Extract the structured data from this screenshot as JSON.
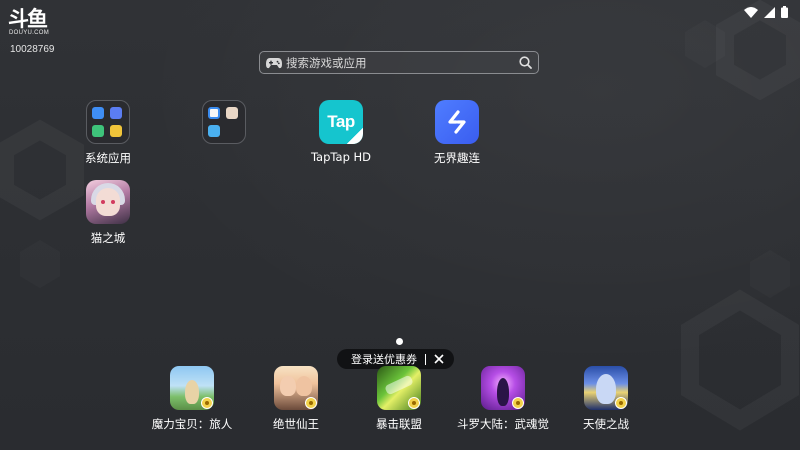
{
  "brand": {
    "logo_mark": "斗鱼",
    "logo_sub": "DOUYU.COM",
    "device_id": "10028769"
  },
  "status_bar": {
    "icons": [
      "wifi-icon",
      "signal-icon",
      "battery-icon"
    ]
  },
  "search": {
    "placeholder": "搜索游戏或应用",
    "left_icon": "gamepad-icon",
    "right_icon": "search-icon"
  },
  "apps": [
    {
      "label": "系统应用",
      "icon": "folder-icon"
    },
    {
      "label": "",
      "icon": "folder-icon"
    },
    {
      "label": "TapTap HD",
      "icon": "taptap-icon",
      "tile_text": "Tap"
    },
    {
      "label": "无界趣连",
      "icon": "wujie-icon"
    },
    {
      "label": "猫之城",
      "icon": "game-cat-icon"
    }
  ],
  "pager": {
    "current": 1
  },
  "toast": {
    "text": "登录送优惠券",
    "close_icon": "close-icon"
  },
  "dock": [
    {
      "label": "魔力宝贝：旅人"
    },
    {
      "label": "绝世仙王"
    },
    {
      "label": "暴击联盟"
    },
    {
      "label": "斗罗大陆：武魂觉"
    },
    {
      "label": "天使之战"
    }
  ],
  "colors": {
    "background": "#2d2f33",
    "taptap": "#15c5ce",
    "wujie": "#4f7dff",
    "toast_bg": "#111214"
  }
}
